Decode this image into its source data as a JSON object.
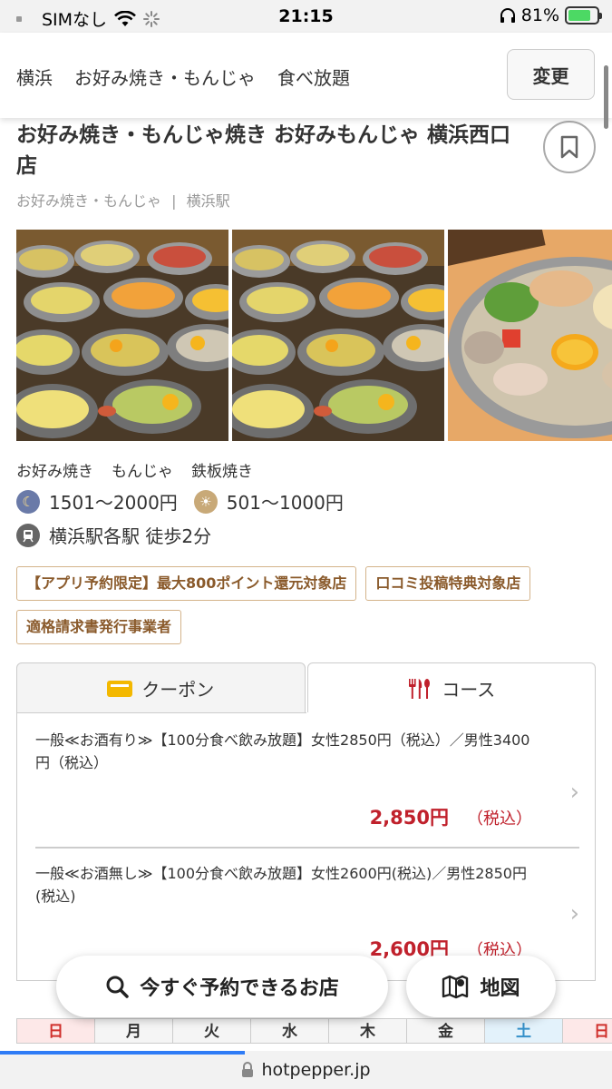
{
  "status_bar": {
    "carrier": "SIMなし",
    "time": "21:15",
    "battery_percent": "81%",
    "battery_level": 0.81
  },
  "search": {
    "crumbs": [
      "横浜",
      "お好み焼き・もんじゃ",
      "食べ放題"
    ],
    "change_label": "変更"
  },
  "shop": {
    "title": "お好み焼き・もんじゃ焼き お好みもんじゃ 横浜西口店",
    "category": "お好み焼き・もんじゃ",
    "separator": "|",
    "station": "横浜駅"
  },
  "info": {
    "genres": [
      "お好み焼き",
      "もんじゃ",
      "鉄板焼き"
    ],
    "budget_dinner": "1501～2000円",
    "budget_lunch": "501～1000円",
    "access": "横浜駅各駅 徒歩2分"
  },
  "tags": [
    "【アプリ予約限定】最大800ポイント還元対象店",
    "口コミ投稿特典対象店",
    "適格請求書発行事業者"
  ],
  "tabs": {
    "coupon": "クーポン",
    "course": "コース"
  },
  "courses": [
    {
      "name": "一般≪お酒有り≫【100分食べ飲み放題】女性2850円（税込）／男性3400円（税込）",
      "price": "2,850円",
      "tax": "（税込）"
    },
    {
      "name": "一般≪お酒無し≫【100分食べ飲み放題】女性2600円(税込)／男性2850円(税込)",
      "price": "2,600円",
      "tax": "（税込）"
    }
  ],
  "floating": {
    "reserve_label": "今すぐ予約できるお店",
    "map_label": "地図"
  },
  "calendar": {
    "days": [
      "日",
      "月",
      "火",
      "水",
      "木",
      "金",
      "土",
      "日"
    ]
  },
  "url_bar": {
    "domain": "hotpepper.jp"
  },
  "colors": {
    "price_red": "#c0212c",
    "tag_border": "#d4b38a",
    "saturday_blue": "#3590c9",
    "sunday_red": "#d0302c"
  }
}
